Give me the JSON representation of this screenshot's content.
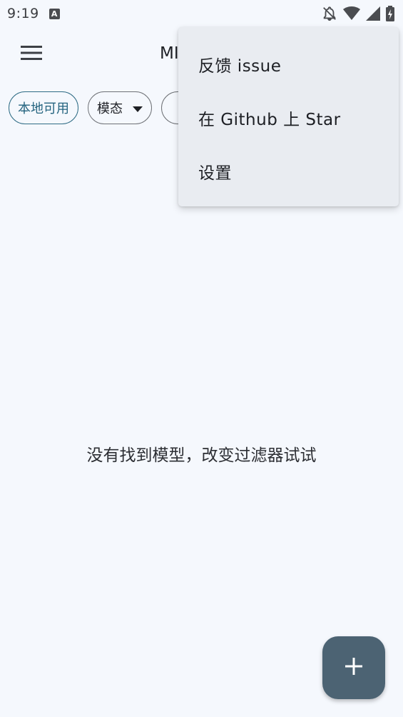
{
  "status_bar": {
    "time": "9:19",
    "app_indicator": "A",
    "icons": [
      "notifications-off-icon",
      "wifi-icon",
      "cellular-signal-icon",
      "battery-charging-icon"
    ]
  },
  "app_bar": {
    "title": "MI",
    "menu_icon": "hamburger-menu-icon"
  },
  "filters": {
    "chips": [
      {
        "label": "本地可用",
        "selected": true
      },
      {
        "label": "模态",
        "dropdown": true
      },
      {
        "label": "",
        "partially_hidden": true
      }
    ]
  },
  "empty_state": {
    "message": "没有找到模型，改变过滤器试试"
  },
  "fab": {
    "icon": "plus-icon"
  },
  "overflow_menu": {
    "items": [
      {
        "label": "反馈 issue"
      },
      {
        "label": "在 Github 上 Star"
      },
      {
        "label": "设置"
      }
    ]
  },
  "colors": {
    "background": "#f5f8fd",
    "accent": "#24637f",
    "fab": "#4c6373",
    "menu_surface": "#e9ecf1"
  }
}
